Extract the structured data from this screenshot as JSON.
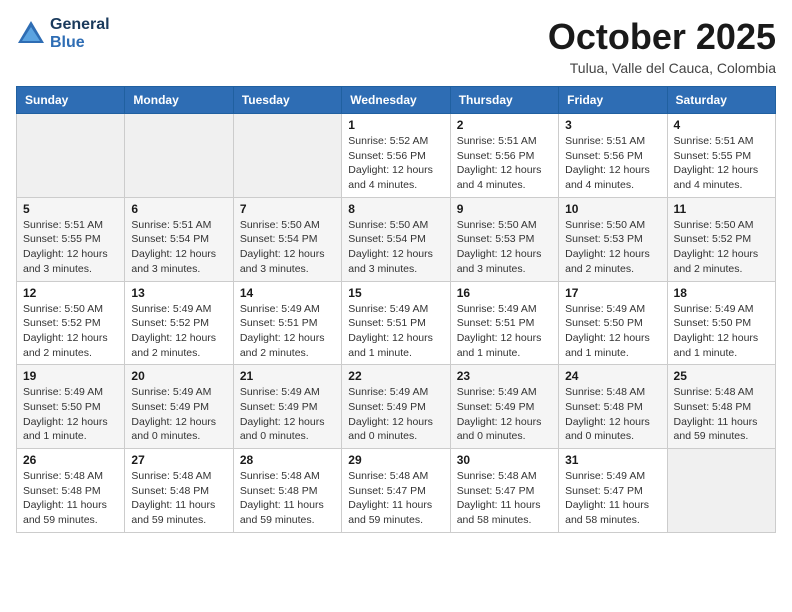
{
  "logo": {
    "line1": "General",
    "line2": "Blue"
  },
  "title": "October 2025",
  "subtitle": "Tulua, Valle del Cauca, Colombia",
  "days_of_week": [
    "Sunday",
    "Monday",
    "Tuesday",
    "Wednesday",
    "Thursday",
    "Friday",
    "Saturday"
  ],
  "weeks": [
    [
      {
        "day": "",
        "info": ""
      },
      {
        "day": "",
        "info": ""
      },
      {
        "day": "",
        "info": ""
      },
      {
        "day": "1",
        "info": "Sunrise: 5:52 AM\nSunset: 5:56 PM\nDaylight: 12 hours and 4 minutes."
      },
      {
        "day": "2",
        "info": "Sunrise: 5:51 AM\nSunset: 5:56 PM\nDaylight: 12 hours and 4 minutes."
      },
      {
        "day": "3",
        "info": "Sunrise: 5:51 AM\nSunset: 5:56 PM\nDaylight: 12 hours and 4 minutes."
      },
      {
        "day": "4",
        "info": "Sunrise: 5:51 AM\nSunset: 5:55 PM\nDaylight: 12 hours and 4 minutes."
      }
    ],
    [
      {
        "day": "5",
        "info": "Sunrise: 5:51 AM\nSunset: 5:55 PM\nDaylight: 12 hours and 3 minutes."
      },
      {
        "day": "6",
        "info": "Sunrise: 5:51 AM\nSunset: 5:54 PM\nDaylight: 12 hours and 3 minutes."
      },
      {
        "day": "7",
        "info": "Sunrise: 5:50 AM\nSunset: 5:54 PM\nDaylight: 12 hours and 3 minutes."
      },
      {
        "day": "8",
        "info": "Sunrise: 5:50 AM\nSunset: 5:54 PM\nDaylight: 12 hours and 3 minutes."
      },
      {
        "day": "9",
        "info": "Sunrise: 5:50 AM\nSunset: 5:53 PM\nDaylight: 12 hours and 3 minutes."
      },
      {
        "day": "10",
        "info": "Sunrise: 5:50 AM\nSunset: 5:53 PM\nDaylight: 12 hours and 2 minutes."
      },
      {
        "day": "11",
        "info": "Sunrise: 5:50 AM\nSunset: 5:52 PM\nDaylight: 12 hours and 2 minutes."
      }
    ],
    [
      {
        "day": "12",
        "info": "Sunrise: 5:50 AM\nSunset: 5:52 PM\nDaylight: 12 hours and 2 minutes."
      },
      {
        "day": "13",
        "info": "Sunrise: 5:49 AM\nSunset: 5:52 PM\nDaylight: 12 hours and 2 minutes."
      },
      {
        "day": "14",
        "info": "Sunrise: 5:49 AM\nSunset: 5:51 PM\nDaylight: 12 hours and 2 minutes."
      },
      {
        "day": "15",
        "info": "Sunrise: 5:49 AM\nSunset: 5:51 PM\nDaylight: 12 hours and 1 minute."
      },
      {
        "day": "16",
        "info": "Sunrise: 5:49 AM\nSunset: 5:51 PM\nDaylight: 12 hours and 1 minute."
      },
      {
        "day": "17",
        "info": "Sunrise: 5:49 AM\nSunset: 5:50 PM\nDaylight: 12 hours and 1 minute."
      },
      {
        "day": "18",
        "info": "Sunrise: 5:49 AM\nSunset: 5:50 PM\nDaylight: 12 hours and 1 minute."
      }
    ],
    [
      {
        "day": "19",
        "info": "Sunrise: 5:49 AM\nSunset: 5:50 PM\nDaylight: 12 hours and 1 minute."
      },
      {
        "day": "20",
        "info": "Sunrise: 5:49 AM\nSunset: 5:49 PM\nDaylight: 12 hours and 0 minutes."
      },
      {
        "day": "21",
        "info": "Sunrise: 5:49 AM\nSunset: 5:49 PM\nDaylight: 12 hours and 0 minutes."
      },
      {
        "day": "22",
        "info": "Sunrise: 5:49 AM\nSunset: 5:49 PM\nDaylight: 12 hours and 0 minutes."
      },
      {
        "day": "23",
        "info": "Sunrise: 5:49 AM\nSunset: 5:49 PM\nDaylight: 12 hours and 0 minutes."
      },
      {
        "day": "24",
        "info": "Sunrise: 5:48 AM\nSunset: 5:48 PM\nDaylight: 12 hours and 0 minutes."
      },
      {
        "day": "25",
        "info": "Sunrise: 5:48 AM\nSunset: 5:48 PM\nDaylight: 11 hours and 59 minutes."
      }
    ],
    [
      {
        "day": "26",
        "info": "Sunrise: 5:48 AM\nSunset: 5:48 PM\nDaylight: 11 hours and 59 minutes."
      },
      {
        "day": "27",
        "info": "Sunrise: 5:48 AM\nSunset: 5:48 PM\nDaylight: 11 hours and 59 minutes."
      },
      {
        "day": "28",
        "info": "Sunrise: 5:48 AM\nSunset: 5:48 PM\nDaylight: 11 hours and 59 minutes."
      },
      {
        "day": "29",
        "info": "Sunrise: 5:48 AM\nSunset: 5:47 PM\nDaylight: 11 hours and 59 minutes."
      },
      {
        "day": "30",
        "info": "Sunrise: 5:48 AM\nSunset: 5:47 PM\nDaylight: 11 hours and 58 minutes."
      },
      {
        "day": "31",
        "info": "Sunrise: 5:49 AM\nSunset: 5:47 PM\nDaylight: 11 hours and 58 minutes."
      },
      {
        "day": "",
        "info": ""
      }
    ]
  ]
}
